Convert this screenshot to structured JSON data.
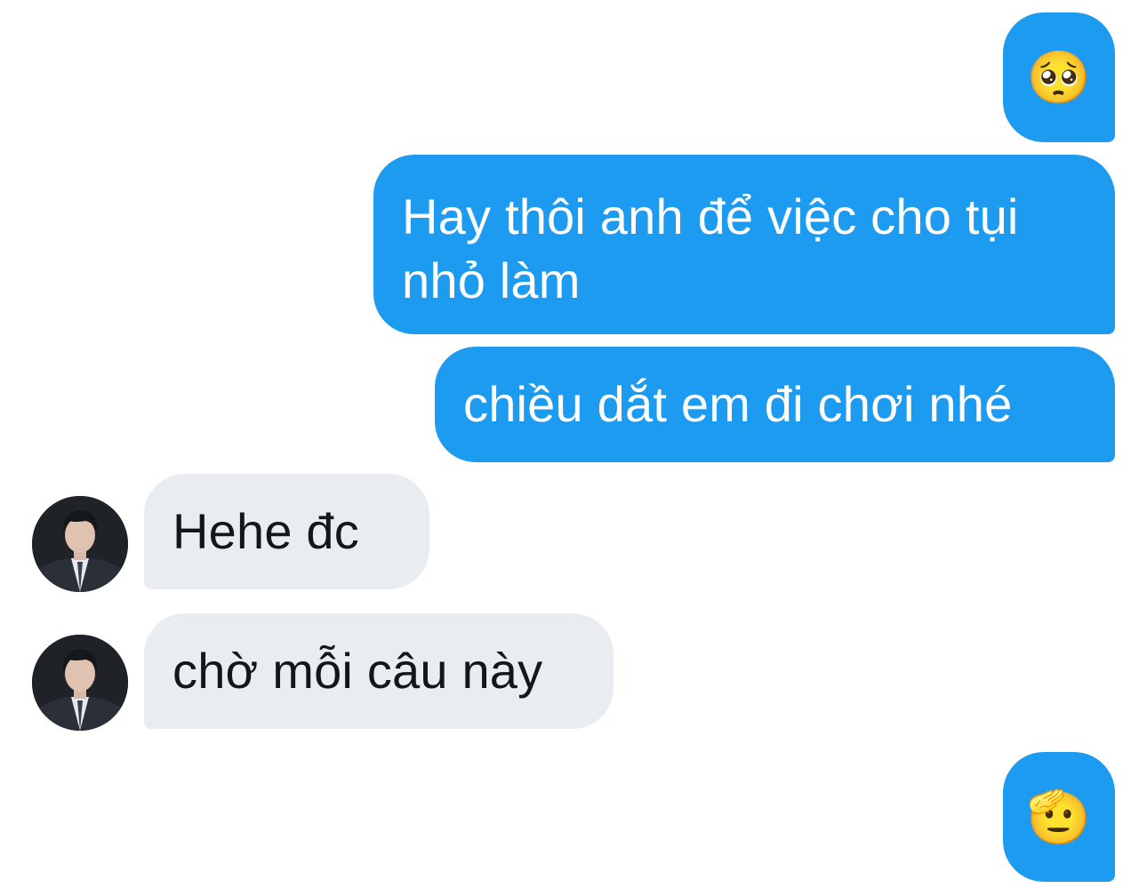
{
  "messages": [
    {
      "direction": "outgoing",
      "text": "🥺"
    },
    {
      "direction": "outgoing",
      "text": "Hay thôi anh để việc cho tụi nhỏ làm"
    },
    {
      "direction": "outgoing",
      "text": "chiều dắt em đi chơi nhé"
    },
    {
      "direction": "incoming",
      "text": "Hehe đc"
    },
    {
      "direction": "incoming",
      "text": "chờ mỗi câu này"
    },
    {
      "direction": "outgoing",
      "text": "🫡"
    }
  ],
  "colors": {
    "outgoing_bubble": "#1d9bf0",
    "incoming_bubble": "#e9edf2",
    "outgoing_text": "#ffffff",
    "incoming_text": "#14171a",
    "background": "#ffffff"
  },
  "icons": {
    "avatar": "contact-avatar-icon"
  }
}
